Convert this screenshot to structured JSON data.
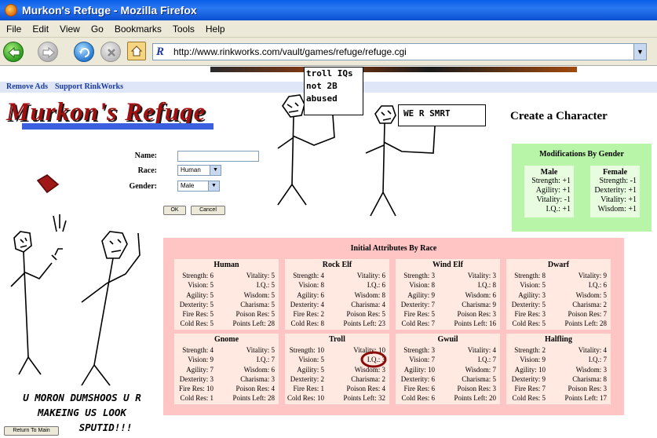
{
  "window": {
    "title": "Murkon's Refuge - Mozilla Firefox"
  },
  "menu": [
    "File",
    "Edit",
    "View",
    "Go",
    "Bookmarks",
    "Tools",
    "Help"
  ],
  "toolbar": {
    "url": "http://www.rinkworks.com/vault/games/refuge/refuge.cgi"
  },
  "adbar": {
    "remove_ads": "Remove Ads",
    "support": "Support RinkWorks"
  },
  "logo": "Murkon's Refuge",
  "heading": "Create a Character",
  "form": {
    "name_label": "Name:",
    "name_value": "",
    "race_label": "Race:",
    "race_value": "Human",
    "gender_label": "Gender:",
    "gender_value": "Male",
    "ok_label": "OK",
    "cancel_label": "Cancel"
  },
  "gender_mods": {
    "title": "Modifications By Gender",
    "male": {
      "label": "Male",
      "rows": [
        "Strength: +1",
        "Agility: +1",
        "Vitality: -1",
        "I.Q.: +1"
      ]
    },
    "female": {
      "label": "Female",
      "rows": [
        "Strength: -1",
        "Dexterity: +1",
        "Vitality: +1",
        "Wisdom: +1"
      ]
    }
  },
  "races": {
    "title": "Initial Attributes By Race",
    "list": [
      {
        "name": "Human",
        "left": [
          "Strength: 6",
          "Vision: 5",
          "Agility: 5",
          "Dexterity: 5",
          "Fire Res: 5",
          "Cold Res: 5"
        ],
        "right": [
          "Vitality: 5",
          "I.Q.: 5",
          "Wisdom: 5",
          "Charisma: 5",
          "Poison Res: 5",
          "Points Left: 28"
        ]
      },
      {
        "name": "Rock Elf",
        "left": [
          "Strength: 4",
          "Vision: 8",
          "Agility: 6",
          "Dexterity: 4",
          "Fire Res: 2",
          "Cold Res: 8"
        ],
        "right": [
          "Vitality: 6",
          "I.Q.: 6",
          "Wisdom: 8",
          "Charisma: 4",
          "Poison Res: 5",
          "Points Left: 23"
        ]
      },
      {
        "name": "Wind Elf",
        "left": [
          "Strength: 3",
          "Vision: 8",
          "Agility: 9",
          "Dexterity: 7",
          "Fire Res: 5",
          "Cold Res: 7"
        ],
        "right": [
          "Vitality: 3",
          "I.Q.: 8",
          "Wisdom: 6",
          "Charisma: 9",
          "Poison Res: 3",
          "Points Left: 16"
        ]
      },
      {
        "name": "Dwarf",
        "left": [
          "Strength: 8",
          "Vision: 5",
          "Agility: 3",
          "Dexterity: 5",
          "Fire Res: 3",
          "Cold Res: 5"
        ],
        "right": [
          "Vitality: 9",
          "I.Q.: 6",
          "Wisdom: 5",
          "Charisma: 2",
          "Poison Res: 7",
          "Points Left: 28"
        ]
      },
      {
        "name": "Gnome",
        "left": [
          "Strength: 4",
          "Vision: 9",
          "Agility: 7",
          "Dexterity: 3",
          "Fire Res: 10",
          "Cold Res: 1"
        ],
        "right": [
          "Vitality: 5",
          "I.Q.: 7",
          "Wisdom: 6",
          "Charisma: 3",
          "Poison Res: 4",
          "Points Left: 28"
        ]
      },
      {
        "name": "Troll",
        "left": [
          "Strength: 10",
          "Vision: 5",
          "Agility: 5",
          "Dexterity: 2",
          "Fire Res: 1",
          "Cold Res: 10"
        ],
        "right": [
          "Vitality: 10",
          "I.Q.: 3",
          "Wisdom: 3",
          "Charisma: 2",
          "Poison Res: 4",
          "Points Left: 32"
        ]
      },
      {
        "name": "Gwuil",
        "left": [
          "Strength: 3",
          "Vision: 7",
          "Agility: 10",
          "Dexterity: 6",
          "Fire Res: 6",
          "Cold Res: 6"
        ],
        "right": [
          "Vitality: 4",
          "I.Q.: 7",
          "Wisdom: 7",
          "Charisma: 5",
          "Poison Res: 3",
          "Points Left: 20"
        ]
      },
      {
        "name": "Halfling",
        "left": [
          "Strength: 2",
          "Vision: 9",
          "Agility: 10",
          "Dexterity: 9",
          "Fire Res: 7",
          "Cold Res: 5"
        ],
        "right": [
          "Vitality: 4",
          "I.Q.: 7",
          "Wisdom: 3",
          "Charisma: 8",
          "Poison Res: 3",
          "Points Left: 17"
        ]
      }
    ]
  },
  "doodle": {
    "sign1": [
      "troll IQs",
      "not 2B",
      "abused"
    ],
    "sign2": "WE R SMRT",
    "bottom": [
      "U MORON DUMSHOOS U R",
      "MAKEING US LOOK",
      "SPUTID!!!"
    ]
  },
  "return_label": "Return To Main"
}
